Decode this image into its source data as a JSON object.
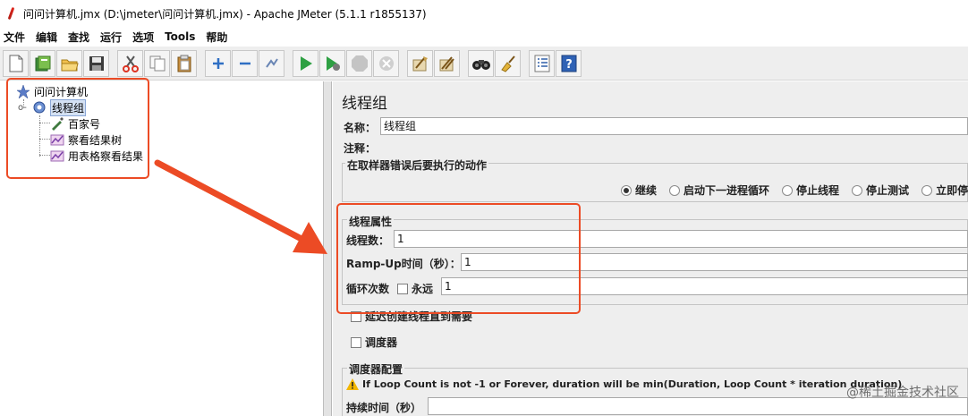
{
  "window": {
    "title": "问问计算机.jmx (D:\\jmeter\\问问计算机.jmx) - Apache JMeter (5.1.1 r1855137)"
  },
  "menubar": {
    "items": [
      "文件",
      "编辑",
      "查找",
      "运行",
      "选项",
      "Tools",
      "帮助"
    ]
  },
  "toolbar": {
    "buttons": [
      {
        "icon": "new-icon"
      },
      {
        "icon": "templates-icon"
      },
      {
        "icon": "open-icon"
      },
      {
        "icon": "save-icon"
      },
      {
        "icon": "cut-icon"
      },
      {
        "icon": "copy-icon"
      },
      {
        "icon": "paste-icon"
      },
      {
        "icon": "expand-icon"
      },
      {
        "icon": "collapse-icon"
      },
      {
        "icon": "toggle-icon"
      },
      {
        "icon": "start-icon"
      },
      {
        "icon": "start-no-pause-icon"
      },
      {
        "icon": "stop-icon"
      },
      {
        "icon": "shutdown-icon"
      },
      {
        "icon": "clear-icon"
      },
      {
        "icon": "clear-all-icon"
      },
      {
        "icon": "search-icon"
      },
      {
        "icon": "reset-search-icon"
      },
      {
        "icon": "function-helper-icon"
      },
      {
        "icon": "help-icon"
      }
    ]
  },
  "tree": {
    "root": "问问计算机",
    "thread_group": "线程组",
    "children": [
      "百家号",
      "察看结果树",
      "用表格察看结果"
    ]
  },
  "main": {
    "title": "线程组",
    "name_label": "名称：",
    "name_value": "线程组",
    "comment_label": "注释：",
    "error_action": {
      "title": "在取样器错误后要执行的动作",
      "options": [
        "继续",
        "启动下一进程循环",
        "停止线程",
        "停止测试",
        "立即停"
      ],
      "selected": "继续"
    },
    "thread_props": {
      "title": "线程属性",
      "threads_label": "线程数：",
      "threads_value": "1",
      "rampup_label": "Ramp-Up时间（秒）：",
      "rampup_value": "1",
      "loop_label": "循环次数",
      "forever_label": "永远",
      "loop_value": "1"
    },
    "delay_label": "延迟创建线程直到需要",
    "scheduler_label": "调度器",
    "scheduler_config": {
      "title": "调度器配置",
      "warning": "If Loop Count is not -1 or Forever, duration will be min(Duration, Loop Count * iteration duration)",
      "duration_label": "持续时间（秒）"
    }
  },
  "watermark": "@稀土掘金技术社区",
  "colors": {
    "annotation": "#ec4b25",
    "selection": "#d4e1f3",
    "panel_bg": "#eeeeee"
  }
}
